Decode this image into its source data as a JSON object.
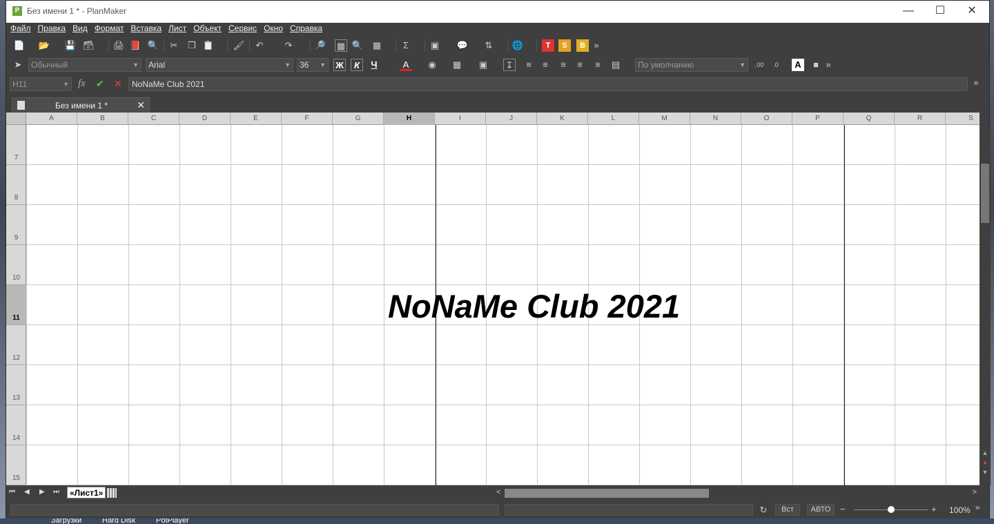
{
  "window": {
    "title": "Без имени 1 * - PlanMaker",
    "app_icon": "P"
  },
  "menu": [
    "Файл",
    "Правка",
    "Вид",
    "Формат",
    "Вставка",
    "Лист",
    "Объект",
    "Сервис",
    "Окно",
    "Справка"
  ],
  "toolbar2": {
    "style": "Обычный",
    "font": "Arial",
    "size": "36",
    "bold": "Ж",
    "italic": "К",
    "underline": "Ч",
    "number_format": "По умолчанию"
  },
  "formula_bar": {
    "cell_ref": "H11",
    "fx": "fx",
    "value": "NoNaMe Club 2021"
  },
  "document_tab": {
    "label": "Без имени 1 *"
  },
  "grid": {
    "columns": [
      "A",
      "B",
      "C",
      "D",
      "E",
      "F",
      "G",
      "H",
      "I",
      "J",
      "K",
      "L",
      "M",
      "N",
      "O",
      "P",
      "Q",
      "R",
      "S"
    ],
    "selected_column": "H",
    "rows": [
      "7",
      "8",
      "9",
      "10",
      "11",
      "12",
      "13",
      "14",
      "15"
    ],
    "selected_row": "11",
    "cell_text": "NoNaMe Club 2021"
  },
  "sheet_tab": "«Лист1»",
  "status": {
    "insert": "Вст",
    "mode": "АВТО",
    "zoom": "100%",
    "zoom_level": 0.5
  },
  "taskbar": [
    "Загрузки",
    "Hard Disk",
    "PotPlayer"
  ]
}
